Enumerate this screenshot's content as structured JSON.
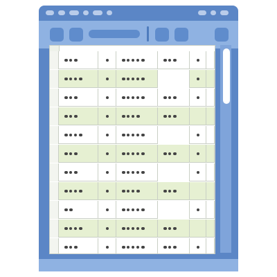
{
  "colors": {
    "window_frame": "#5b86c6",
    "toolbar": "#8fb2e2",
    "row_alt": "#e6f0d2",
    "row_plain": "#ffffff",
    "gridline": "#c9cfc5"
  },
  "icons": [
    "menu-blob",
    "toolbar-button-icon",
    "toolbar-field",
    "scrollbar-thumb"
  ],
  "grid": {
    "row_count": 11,
    "column_count": 6,
    "rows": [
      {
        "cells": [
          3,
          1,
          5,
          3,
          1,
          0
        ]
      },
      {
        "cells": [
          4,
          1,
          5,
          0,
          1,
          0
        ]
      },
      {
        "cells": [
          3,
          1,
          5,
          3,
          1,
          0
        ]
      },
      {
        "cells": [
          3,
          1,
          4,
          3,
          0,
          0
        ]
      },
      {
        "cells": [
          4,
          1,
          5,
          0,
          1,
          0
        ]
      },
      {
        "cells": [
          3,
          1,
          5,
          3,
          1,
          0
        ]
      },
      {
        "cells": [
          3,
          1,
          5,
          0,
          1,
          0
        ]
      },
      {
        "cells": [
          4,
          1,
          4,
          3,
          0,
          0
        ]
      },
      {
        "cells": [
          2,
          1,
          5,
          0,
          1,
          0
        ]
      },
      {
        "cells": [
          4,
          1,
          5,
          3,
          0,
          0
        ]
      },
      {
        "cells": [
          3,
          1,
          5,
          3,
          1,
          0
        ]
      }
    ]
  }
}
